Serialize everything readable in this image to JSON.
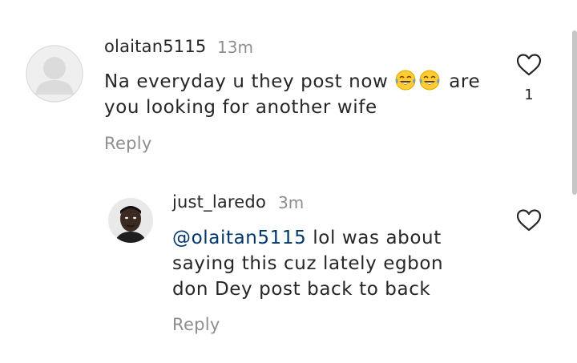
{
  "comments": [
    {
      "username": "olaitan5115",
      "time": "13m",
      "text_before": "Na everyday u they post now ",
      "emojis": [
        "face-with-tears-of-joy",
        "face-with-tears-of-joy"
      ],
      "text_after": " are you looking for another wife",
      "reply_label": "Reply",
      "like_count": "1",
      "avatar": "default-avatar-icon"
    },
    {
      "username": "just_laredo",
      "time": "3m",
      "mention": "@olaitan5115",
      "text": " lol was about saying this cuz lately egbon don Dey post back to back",
      "reply_label": "Reply",
      "avatar": "profile-photo"
    }
  ],
  "colors": {
    "text": "#262626",
    "secondary": "#8e8e8e",
    "mention": "#00376b",
    "avatar_placeholder": "#dbdbdb"
  }
}
